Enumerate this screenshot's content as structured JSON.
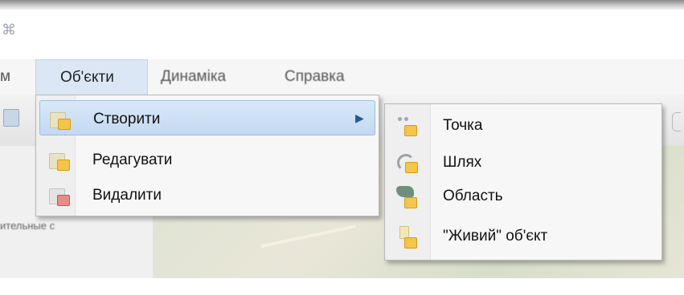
{
  "menubar": {
    "left_partial": "м",
    "objects": "Об'єкти",
    "dynamics": "Динаміка",
    "help": "Справка"
  },
  "objects_menu": {
    "items": [
      {
        "label": "Створити",
        "icon": "create-icon",
        "has_submenu": true,
        "highlighted": true
      },
      {
        "label": "Редагувати",
        "icon": "edit-icon"
      },
      {
        "label": "Видалити",
        "icon": "delete-icon"
      }
    ]
  },
  "create_submenu": {
    "items": [
      {
        "label": "Точка",
        "icon": "point-icon"
      },
      {
        "label": "Шлях",
        "icon": "path-icon"
      },
      {
        "label": "Область",
        "icon": "area-icon"
      },
      {
        "label": "\"Живий\" об'єкт",
        "icon": "live-object-icon"
      }
    ]
  },
  "left_panel": {
    "partial_label": "ительные с"
  },
  "colors": {
    "highlight": "#c3d9f1",
    "menu_bg": "#f7f7f7",
    "folder": "#f4c54a"
  }
}
